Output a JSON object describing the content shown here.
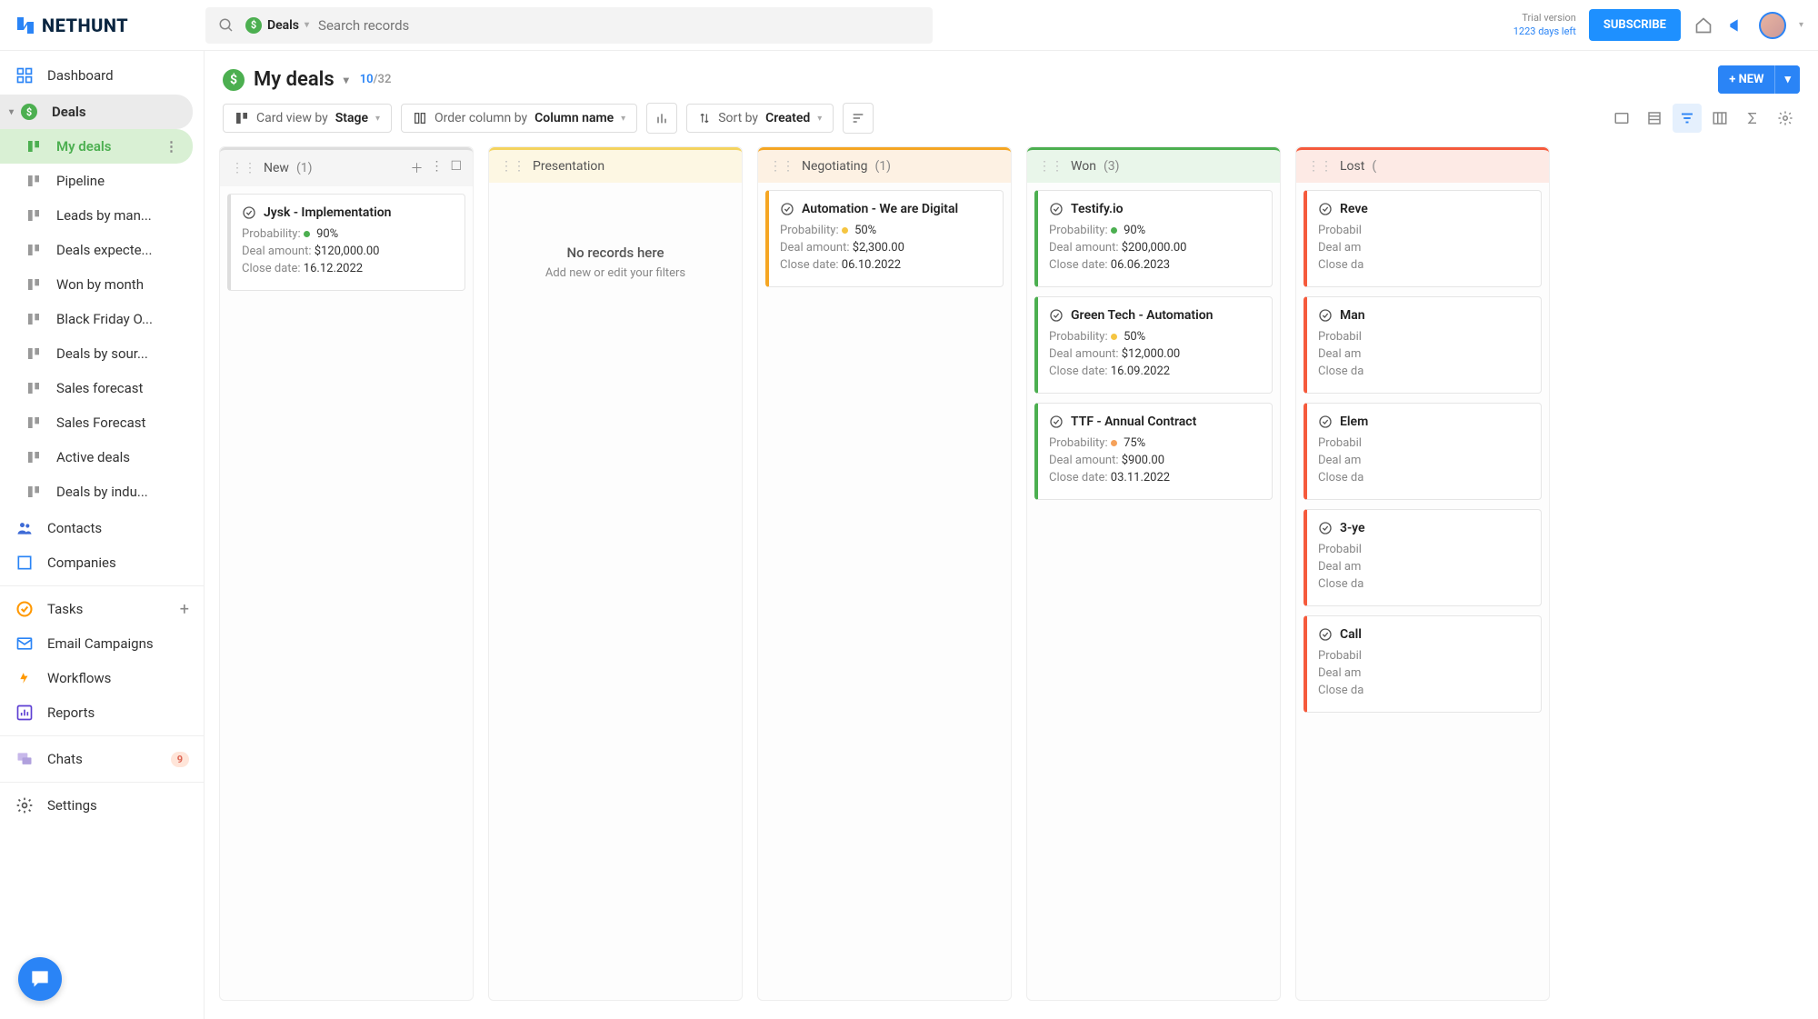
{
  "topbar": {
    "logo": "NETHUNT",
    "search_scope": "Deals",
    "search_placeholder": "Search records",
    "trial_line1": "Trial version",
    "trial_line2": "1223 days left",
    "subscribe": "SUBSCRIBE"
  },
  "sidebar": {
    "dashboard": "Dashboard",
    "deals": "Deals",
    "deals_views": [
      "My deals",
      "Pipeline",
      "Leads by man...",
      "Deals expecte...",
      "Won by month",
      "Black Friday O...",
      "Deals by sour...",
      "Sales forecast",
      "Sales Forecast",
      "Active deals",
      "Deals by indu..."
    ],
    "contacts": "Contacts",
    "companies": "Companies",
    "tasks": "Tasks",
    "email": "Email Campaigns",
    "workflows": "Workflows",
    "reports": "Reports",
    "chats": "Chats",
    "chats_badge": "9",
    "settings": "Settings"
  },
  "header": {
    "title": "My deals",
    "count_shown": "10",
    "count_total": "/32",
    "btn_new": "+ NEW"
  },
  "toolbar": {
    "cardview_lbl": "Card view by",
    "cardview_val": "Stage",
    "order_lbl": "Order column by",
    "order_val": "Column name",
    "sort_lbl": "Sort by",
    "sort_val": "Created"
  },
  "labels": {
    "probability": "Probability:",
    "amount": "Deal amount:",
    "close": "Close date:",
    "empty_title": "No records here",
    "empty_sub": "Add new or edit your filters"
  },
  "columns": [
    {
      "id": "new",
      "name": "New",
      "count": "(1)",
      "klass": "col-new",
      "show_actions": true,
      "cards": [
        {
          "title": "Jysk - Implementation",
          "prob": "90%",
          "prob_color": "#4caf50",
          "amount": "$120,000.00",
          "close": "16.12.2022"
        }
      ]
    },
    {
      "id": "presentation",
      "name": "Presentation",
      "count": "",
      "klass": "col-presentation",
      "cards": [],
      "empty": true
    },
    {
      "id": "negotiating",
      "name": "Negotiating",
      "count": "(1)",
      "klass": "col-negotiating",
      "cards": [
        {
          "title": "Automation - We are Digital",
          "prob": "50%",
          "prob_color": "#f5c542",
          "amount": "$2,300.00",
          "close": "06.10.2022"
        }
      ]
    },
    {
      "id": "won",
      "name": "Won",
      "count": "(3)",
      "klass": "col-won",
      "cards": [
        {
          "title": "Testify.io",
          "prob": "90%",
          "prob_color": "#4caf50",
          "amount": "$200,000.00",
          "close": "06.06.2023"
        },
        {
          "title": "Green Tech - Automation",
          "prob": "50%",
          "prob_color": "#f5c542",
          "amount": "$12,000.00",
          "close": "16.09.2022"
        },
        {
          "title": "TTF - Annual Contract",
          "prob": "75%",
          "prob_color": "#f5a15a",
          "amount": "$900.00",
          "close": "03.11.2022"
        }
      ]
    },
    {
      "id": "lost",
      "name": "Lost",
      "count": "(",
      "klass": "col-lost",
      "cards": [
        {
          "title": "Reve",
          "prob": "",
          "amount": "",
          "close": "",
          "truncated": true
        },
        {
          "title": "Man",
          "prob": "",
          "amount": "",
          "close": "",
          "truncated": true
        },
        {
          "title": "Elem",
          "prob": "",
          "amount": "",
          "close": "",
          "truncated": true
        },
        {
          "title": "3-ye",
          "prob": "",
          "amount": "",
          "close": "",
          "truncated": true
        },
        {
          "title": "Call",
          "prob": "",
          "amount": "",
          "close": "",
          "truncated": true
        }
      ]
    }
  ]
}
